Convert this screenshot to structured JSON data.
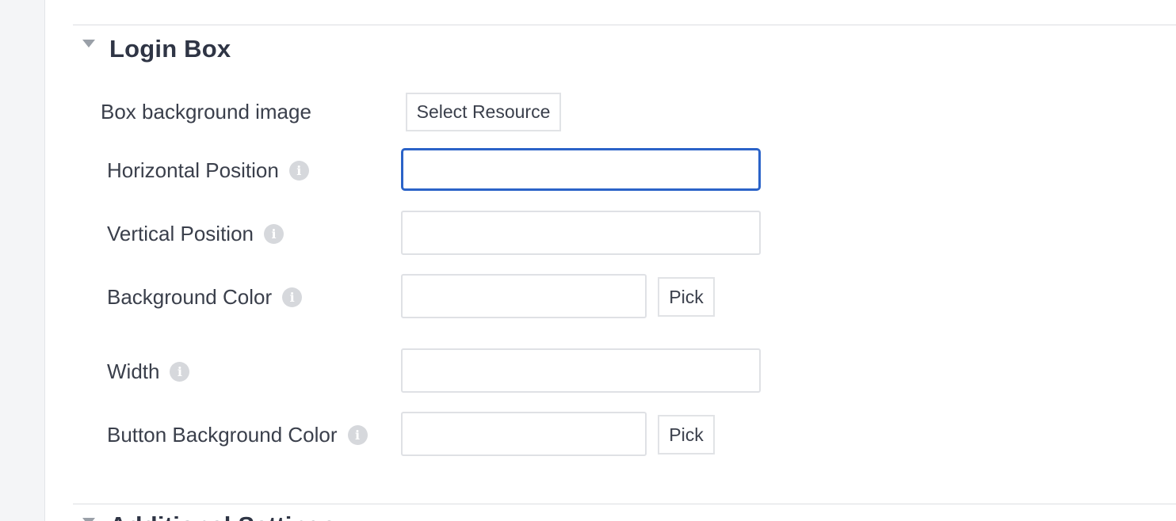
{
  "section": {
    "title": "Login Box"
  },
  "fields": {
    "box_background_image": {
      "label": "Box background image",
      "button_label": "Select Resource"
    },
    "horizontal_position": {
      "label": "Horizontal Position",
      "value": "",
      "placeholder": ""
    },
    "vertical_position": {
      "label": "Vertical Position",
      "value": "",
      "placeholder": ""
    },
    "background_color": {
      "label": "Background Color",
      "value": "",
      "pick_label": "Pick"
    },
    "width": {
      "label": "Width",
      "value": ""
    },
    "button_background_color": {
      "label": "Button Background Color",
      "value": "",
      "pick_label": "Pick"
    }
  },
  "info_icon": {
    "name": "info-icon",
    "glyph": "i"
  },
  "next_section": {
    "title": "Additional Settings"
  },
  "colors": {
    "focus_border": "#2b63c8",
    "text": "#3a3f4b",
    "border": "#dfe1e5"
  }
}
